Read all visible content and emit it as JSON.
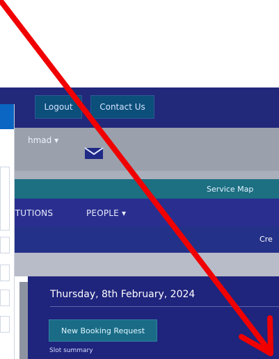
{
  "header": {
    "logout_label": "Logout",
    "contact_label": "Contact Us",
    "user_label": "hmad ▾",
    "mail_icon": "mail-icon"
  },
  "bands": {
    "service_map_label": "Service Map"
  },
  "nav": {
    "institutions_label": "ITUTIONS",
    "people_label": "PEOPLE ▾",
    "create_label": "Cre"
  },
  "main": {
    "date_heading": "Thursday, 8th February, 2024",
    "new_booking_label": "New Booking Request",
    "slot_summary_label": "Slot summary"
  },
  "colors": {
    "arrow": "#f00000",
    "header": "#22287a",
    "teal": "#1d6f82",
    "nav": "#2a2f8f"
  }
}
